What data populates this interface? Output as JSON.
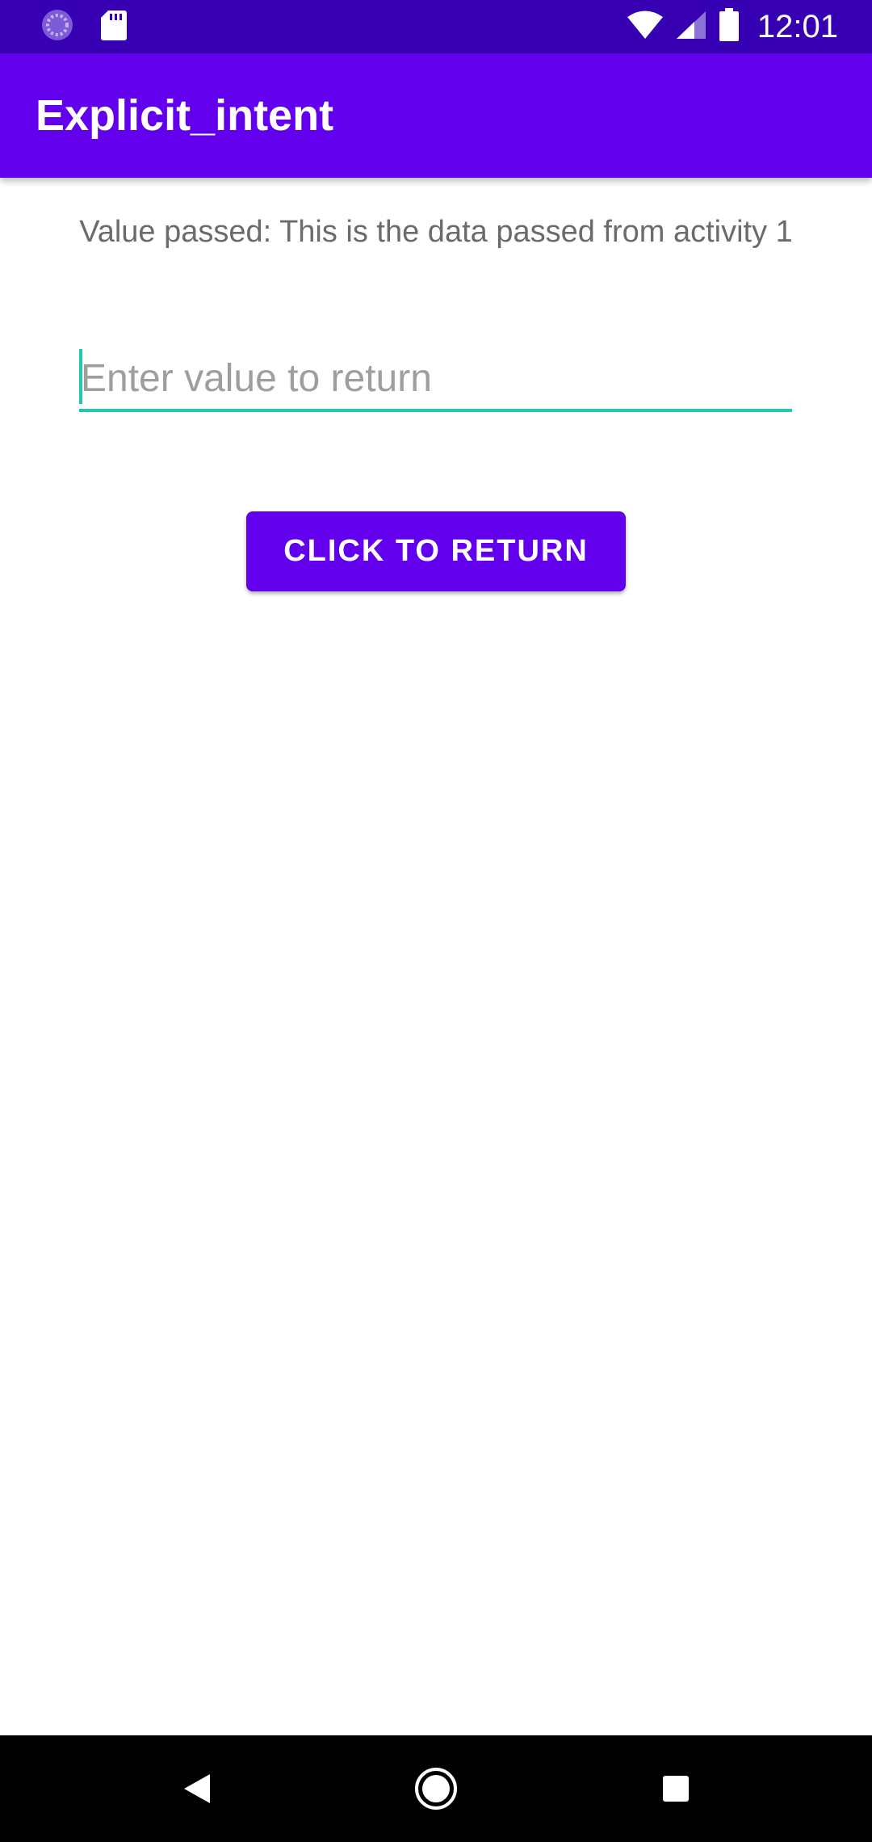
{
  "status_bar": {
    "time": "12:01",
    "left_icons": [
      "loading-icon",
      "sd-card-icon"
    ],
    "right_icons": [
      "wifi-icon",
      "signal-icon",
      "battery-icon"
    ]
  },
  "app_bar": {
    "title": "Explicit_intent"
  },
  "content": {
    "value_passed_text": "Value passed: This is the data passed from activity 1",
    "input": {
      "value": "",
      "placeholder": "Enter value to return"
    },
    "return_button_label": "CLICK TO RETURN"
  },
  "nav_bar": {
    "buttons": [
      "back-icon",
      "home-icon",
      "recents-icon"
    ]
  },
  "colors": {
    "status_bar": "#3700b3",
    "primary": "#6200ee",
    "accent": "#26c6b6",
    "text_secondary": "#6b6b6b",
    "nav_bar": "#000000"
  }
}
